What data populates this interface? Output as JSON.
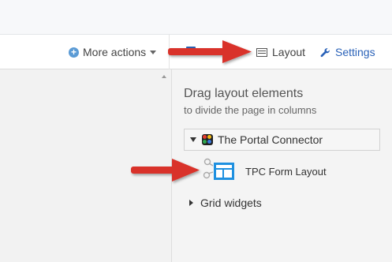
{
  "toolbar": {
    "more_actions_label": "More actions",
    "layout_label": "Layout",
    "settings_label": "Settings"
  },
  "panel": {
    "title": "Drag layout elements",
    "subtitle": "to divide the page in columns",
    "group_label": "The Portal Connector",
    "widget_label": "TPC Form Layout",
    "grid_widgets_label": "Grid widgets"
  },
  "colors": {
    "link_blue": "#2a62b8",
    "arrow_red": "#d9322a",
    "widget_blue": "#1e90e0"
  },
  "icons": [
    "plus-circle-icon",
    "caret-down-icon",
    "layout-icon",
    "wrench-icon",
    "portal-connector-logo",
    "form-layout-widget-icon"
  ]
}
